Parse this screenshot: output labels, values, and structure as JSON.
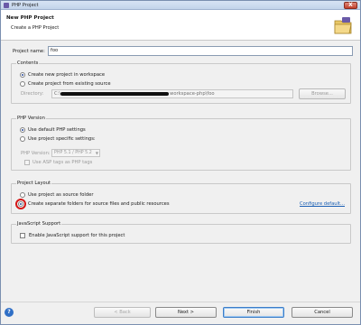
{
  "window": {
    "title": "PHP Project",
    "close_symbol": "X"
  },
  "header": {
    "title": "New PHP Project",
    "subtitle": "Create a PHP Project"
  },
  "project_name": {
    "label": "Project name:",
    "value": "foo"
  },
  "contents": {
    "title": "Contents",
    "options": [
      {
        "label": "Create new project in workspace",
        "checked": true
      },
      {
        "label": "Create project from existing source",
        "checked": false
      }
    ],
    "directory": {
      "label": "Directory:",
      "value_prefix": "C:\\",
      "value_suffix": "workspace-php\\foo"
    },
    "browse_label": "Browse..."
  },
  "php_version": {
    "title": "PHP Version",
    "options": [
      {
        "label": "Use default PHP settings",
        "checked": true
      },
      {
        "label": "Use project specific settings:",
        "checked": false
      }
    ],
    "version_label": "PHP Version:",
    "version_value": "PHP 5.1 / PHP 5.2",
    "asp_tags_label": "Use ASP tags as PHP tags"
  },
  "project_layout": {
    "title": "Project Layout",
    "options": [
      {
        "label": "Use project as source folder",
        "checked": false
      },
      {
        "label": "Create separate folders for source files and public resources",
        "checked": true
      }
    ],
    "configure_link": "Configure default..."
  },
  "javascript_support": {
    "title": "JavaScript Support",
    "enable_label": "Enable JavaScript support for this project"
  },
  "buttons": {
    "help": "?",
    "back": "< Back",
    "next": "Next >",
    "finish": "Finish",
    "cancel": "Cancel"
  },
  "colors": {
    "accent": "#2f6fc6",
    "highlight_ring": "#d41818",
    "link": "#1a5fb4"
  }
}
